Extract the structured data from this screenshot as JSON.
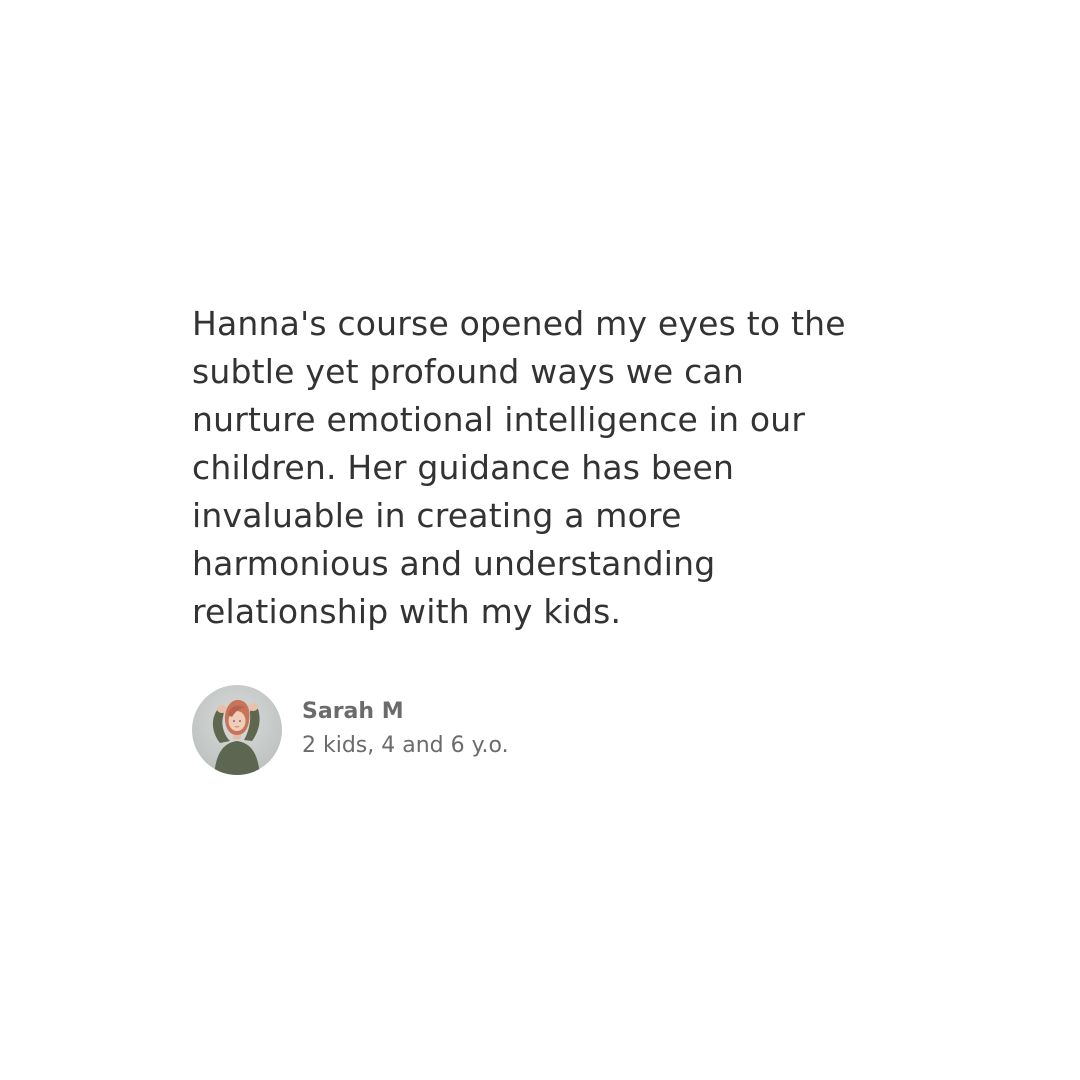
{
  "testimonial": {
    "quote_lines": [
      "Hanna's course opened my eyes to the",
      "subtle yet profound ways we can",
      "nurture emotional intelligence in our",
      "children. Her guidance has been",
      "invaluable in creating a more",
      "harmonious and understanding",
      "relationship with my kids."
    ],
    "author_name": "Sarah M",
    "author_detail": "2 kids, 4 and 6 y.o.",
    "avatar": "person-photo"
  },
  "colors": {
    "background": "#ffffff",
    "quote_text": "#333333",
    "author_text": "#6b6b6b"
  }
}
